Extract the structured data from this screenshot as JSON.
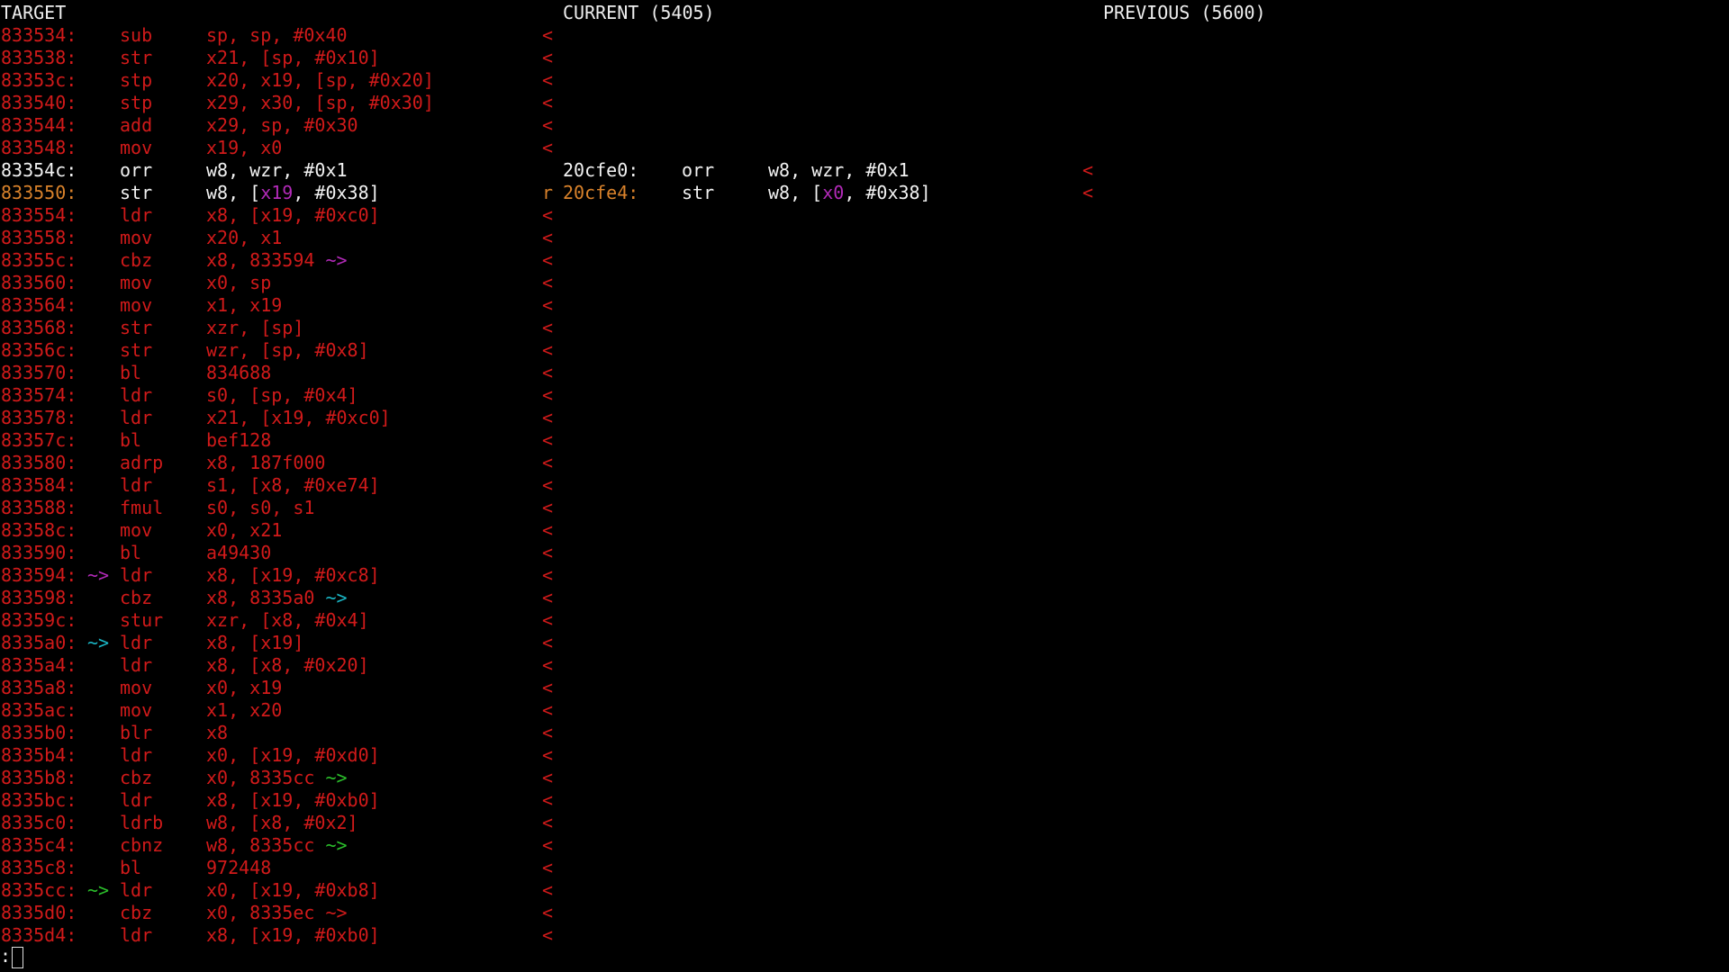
{
  "headers": {
    "target": "TARGET",
    "current": "CURRENT (5405)",
    "previous": "PREVIOUS (5600)"
  },
  "colors": {
    "default": "#f2f2f2",
    "mismatch": "#d11a1a",
    "register_diff": "#b22ab8",
    "branch_magenta": "#b22ab8",
    "branch_cyan": "#1ab6c5",
    "branch_green": "#2bbf2b",
    "partial_match": "#d9822b"
  },
  "target_rows": [
    {
      "addr": "833534:",
      "branch": "",
      "mnem": "sub",
      "ops": "sp, sp, #0x40",
      "marker": "<",
      "color": "red"
    },
    {
      "addr": "833538:",
      "branch": "",
      "mnem": "str",
      "ops": "x21, [sp, #0x10]",
      "marker": "<",
      "color": "red"
    },
    {
      "addr": "83353c:",
      "branch": "",
      "mnem": "stp",
      "ops": "x20, x19, [sp, #0x20]",
      "marker": "<",
      "color": "red"
    },
    {
      "addr": "833540:",
      "branch": "",
      "mnem": "stp",
      "ops": "x29, x30, [sp, #0x30]",
      "marker": "<",
      "color": "red"
    },
    {
      "addr": "833544:",
      "branch": "",
      "mnem": "add",
      "ops": "x29, sp, #0x30",
      "marker": "<",
      "color": "red"
    },
    {
      "addr": "833548:",
      "branch": "",
      "mnem": "mov",
      "ops": "x19, x0",
      "marker": "<",
      "color": "red"
    },
    {
      "addr": "83354c:",
      "branch": "",
      "mnem": "orr",
      "ops": "w8, wzr, #0x1",
      "marker": "",
      "color": "white"
    },
    {
      "addr": "833550:",
      "branch": "",
      "mnem": "str",
      "ops_pre": "w8, [",
      "ops_reg": "x19",
      "ops_post": ", #0x38]",
      "marker": "r",
      "color": "orange"
    },
    {
      "addr": "833554:",
      "branch": "",
      "mnem": "ldr",
      "ops": "x8, [x19, #0xc0]",
      "marker": "<",
      "color": "red"
    },
    {
      "addr": "833558:",
      "branch": "",
      "mnem": "mov",
      "ops": "x20, x1",
      "marker": "<",
      "color": "red"
    },
    {
      "addr": "83355c:",
      "branch": "",
      "mnem": "cbz",
      "ops": "x8, 833594",
      "arrow": "~>",
      "arrow_color": "magenta",
      "marker": "<",
      "color": "red"
    },
    {
      "addr": "833560:",
      "branch": "",
      "mnem": "mov",
      "ops": "x0, sp",
      "marker": "<",
      "color": "red"
    },
    {
      "addr": "833564:",
      "branch": "",
      "mnem": "mov",
      "ops": "x1, x19",
      "marker": "<",
      "color": "red"
    },
    {
      "addr": "833568:",
      "branch": "",
      "mnem": "str",
      "ops": "xzr, [sp]",
      "marker": "<",
      "color": "red"
    },
    {
      "addr": "83356c:",
      "branch": "",
      "mnem": "str",
      "ops": "wzr, [sp, #0x8]",
      "marker": "<",
      "color": "red"
    },
    {
      "addr": "833570:",
      "branch": "",
      "mnem": "bl",
      "ops": "834688",
      "marker": "<",
      "color": "red"
    },
    {
      "addr": "833574:",
      "branch": "",
      "mnem": "ldr",
      "ops": "s0, [sp, #0x4]",
      "marker": "<",
      "color": "red"
    },
    {
      "addr": "833578:",
      "branch": "",
      "mnem": "ldr",
      "ops": "x21, [x19, #0xc0]",
      "marker": "<",
      "color": "red"
    },
    {
      "addr": "83357c:",
      "branch": "",
      "mnem": "bl",
      "ops": "bef128",
      "marker": "<",
      "color": "red"
    },
    {
      "addr": "833580:",
      "branch": "",
      "mnem": "adrp",
      "ops": "x8, 187f000",
      "marker": "<",
      "color": "red"
    },
    {
      "addr": "833584:",
      "branch": "",
      "mnem": "ldr",
      "ops": "s1, [x8, #0xe74]",
      "marker": "<",
      "color": "red"
    },
    {
      "addr": "833588:",
      "branch": "",
      "mnem": "fmul",
      "ops": "s0, s0, s1",
      "marker": "<",
      "color": "red"
    },
    {
      "addr": "83358c:",
      "branch": "",
      "mnem": "mov",
      "ops": "x0, x21",
      "marker": "<",
      "color": "red"
    },
    {
      "addr": "833590:",
      "branch": "",
      "mnem": "bl",
      "ops": "a49430",
      "marker": "<",
      "color": "red"
    },
    {
      "addr": "833594:",
      "branch": "~>",
      "branch_color": "magenta",
      "mnem": "ldr",
      "ops": "x8, [x19, #0xc8]",
      "marker": "<",
      "color": "red"
    },
    {
      "addr": "833598:",
      "branch": "",
      "mnem": "cbz",
      "ops": "x8, 8335a0",
      "arrow": "~>",
      "arrow_color": "cyan",
      "marker": "<",
      "color": "red"
    },
    {
      "addr": "83359c:",
      "branch": "",
      "mnem": "stur",
      "ops": "xzr, [x8, #0x4]",
      "marker": "<",
      "color": "red"
    },
    {
      "addr": "8335a0:",
      "branch": "~>",
      "branch_color": "cyan",
      "mnem": "ldr",
      "ops": "x8, [x19]",
      "marker": "<",
      "color": "red"
    },
    {
      "addr": "8335a4:",
      "branch": "",
      "mnem": "ldr",
      "ops": "x8, [x8, #0x20]",
      "marker": "<",
      "color": "red"
    },
    {
      "addr": "8335a8:",
      "branch": "",
      "mnem": "mov",
      "ops": "x0, x19",
      "marker": "<",
      "color": "red"
    },
    {
      "addr": "8335ac:",
      "branch": "",
      "mnem": "mov",
      "ops": "x1, x20",
      "marker": "<",
      "color": "red"
    },
    {
      "addr": "8335b0:",
      "branch": "",
      "mnem": "blr",
      "ops": "x8",
      "marker": "<",
      "color": "red"
    },
    {
      "addr": "8335b4:",
      "branch": "",
      "mnem": "ldr",
      "ops": "x0, [x19, #0xd0]",
      "marker": "<",
      "color": "red"
    },
    {
      "addr": "8335b8:",
      "branch": "",
      "mnem": "cbz",
      "ops": "x0, 8335cc",
      "arrow": "~>",
      "arrow_color": "green",
      "marker": "<",
      "color": "red"
    },
    {
      "addr": "8335bc:",
      "branch": "",
      "mnem": "ldr",
      "ops": "x8, [x19, #0xb0]",
      "marker": "<",
      "color": "red"
    },
    {
      "addr": "8335c0:",
      "branch": "",
      "mnem": "ldrb",
      "ops": "w8, [x8, #0x2]",
      "marker": "<",
      "color": "red"
    },
    {
      "addr": "8335c4:",
      "branch": "",
      "mnem": "cbnz",
      "ops": "w8, 8335cc",
      "arrow": "~>",
      "arrow_color": "green",
      "marker": "<",
      "color": "red"
    },
    {
      "addr": "8335c8:",
      "branch": "",
      "mnem": "bl",
      "ops": "972448",
      "marker": "<",
      "color": "red"
    },
    {
      "addr": "8335cc:",
      "branch": "~>",
      "branch_color": "green",
      "mnem": "ldr",
      "ops": "x0, [x19, #0xb8]",
      "marker": "<",
      "color": "red"
    },
    {
      "addr": "8335d0:",
      "branch": "",
      "mnem": "cbz",
      "ops": "x0, 8335ec",
      "arrow": "~>",
      "arrow_color": "red",
      "marker": "<",
      "color": "red"
    },
    {
      "addr": "8335d4:",
      "branch": "",
      "mnem": "ldr",
      "ops": "x8, [x19, #0xb0]",
      "marker": "<",
      "color": "red"
    }
  ],
  "current_rows": [
    {
      "row": 6,
      "addr": "20cfe0:",
      "mnem": "orr",
      "ops": "w8, wzr, #0x1",
      "marker": "<",
      "color": "white"
    },
    {
      "row": 7,
      "addr": "20cfe4:",
      "mnem": "str",
      "ops_pre": "w8, [",
      "ops_reg": "x0",
      "ops_post": ", #0x38]",
      "marker": "<",
      "color": "orange"
    }
  ],
  "prompt": ":"
}
